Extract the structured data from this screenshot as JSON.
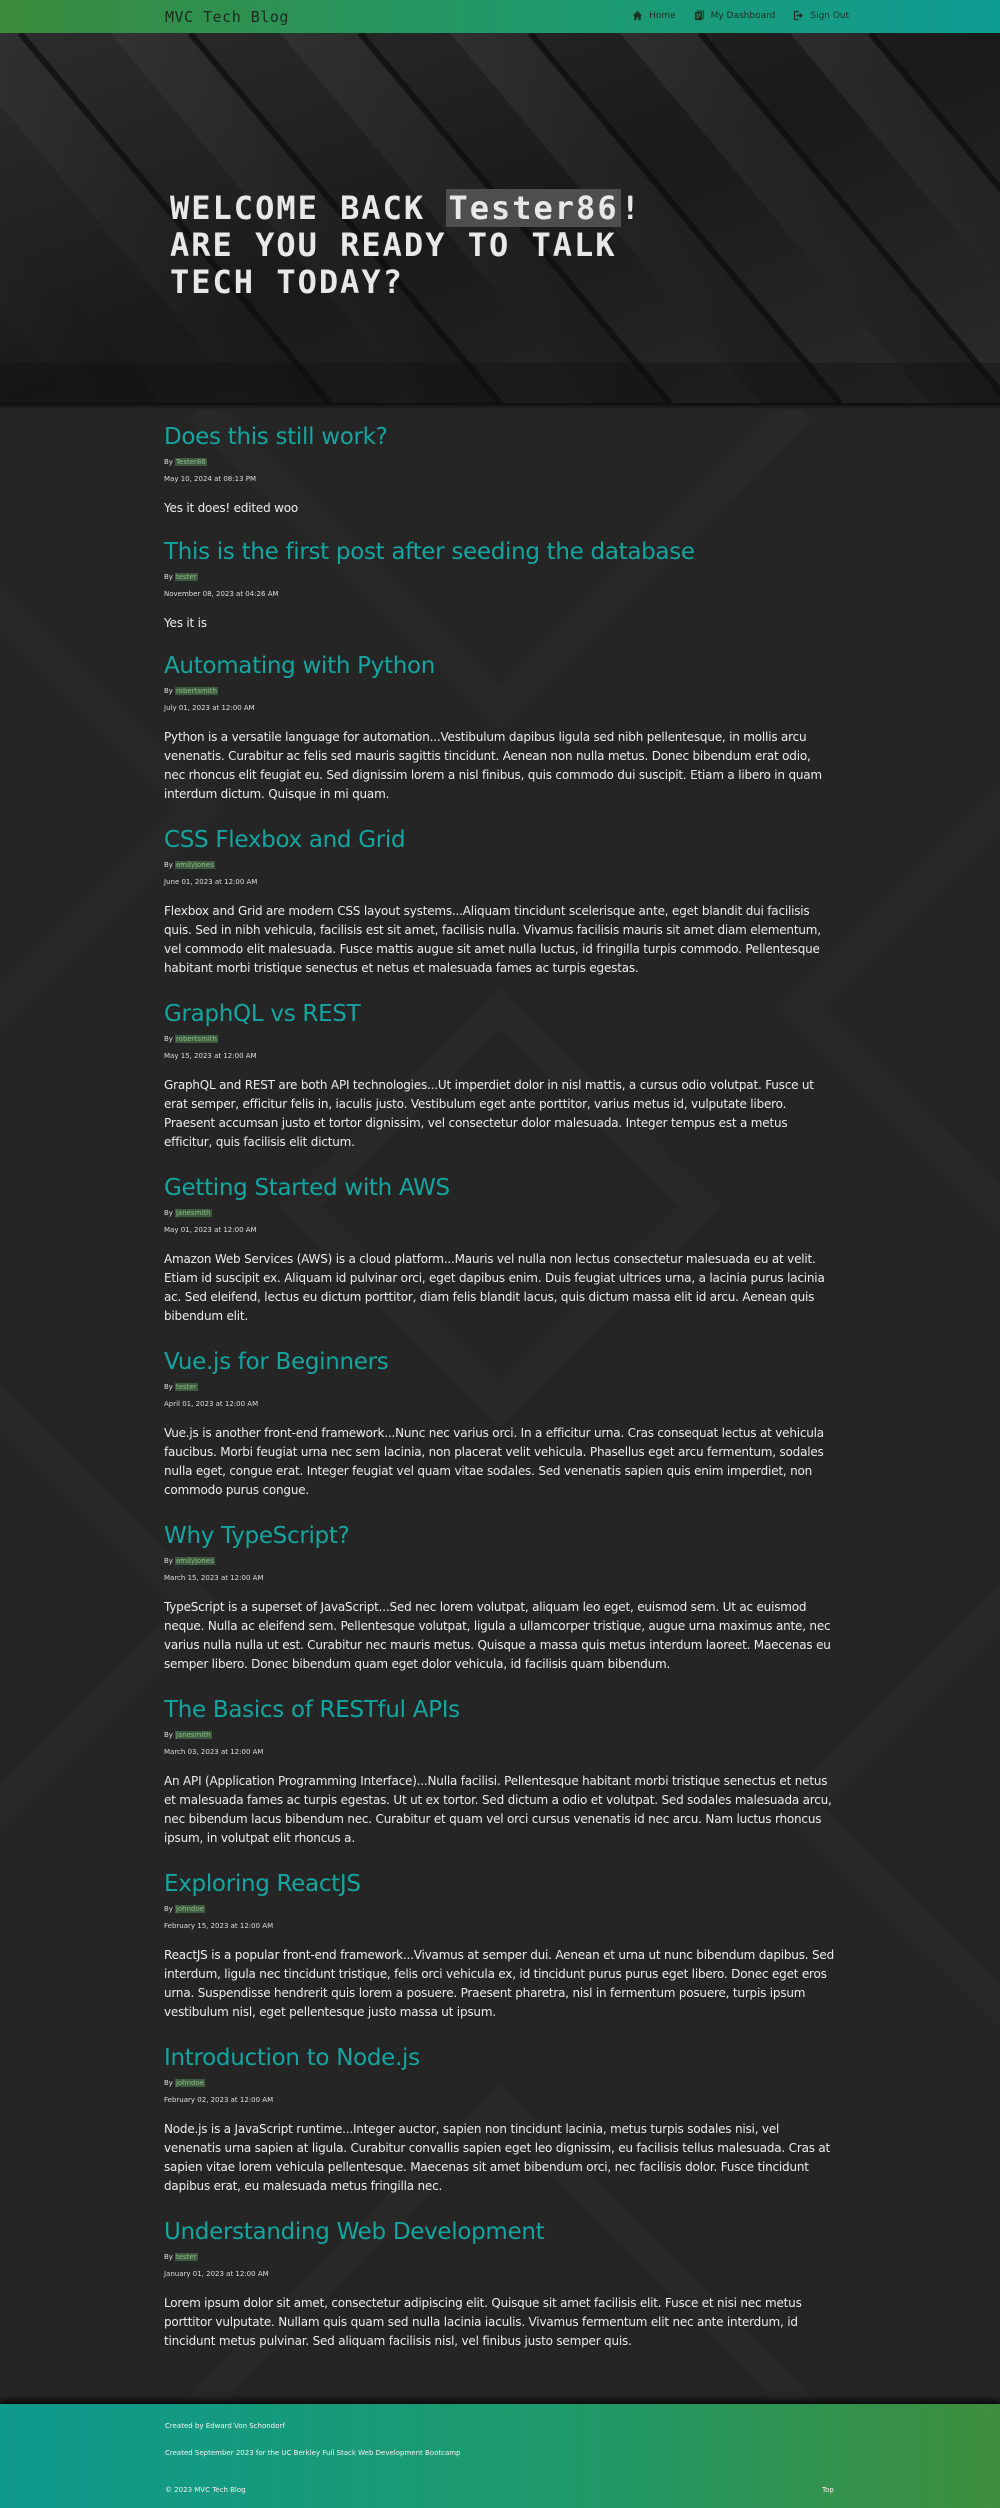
{
  "navbar": {
    "brand": "MVC Tech Blog",
    "links": [
      {
        "label": "Home",
        "icon": "home-icon"
      },
      {
        "label": "My Dashboard",
        "icon": "dashboard-icon"
      },
      {
        "label": "Sign Out",
        "icon": "sign-out-icon"
      }
    ]
  },
  "hero": {
    "line1_prefix": "Welcome back ",
    "username": "Tester86",
    "line1_suffix": "!",
    "line2": "Are you ready to talk",
    "line3": "tech today?"
  },
  "posts": [
    {
      "title": "Does this still work?",
      "by": "By",
      "author": "Tester86",
      "date": "May 10, 2024 at 08:13 PM",
      "content": "Yes it does! edited woo"
    },
    {
      "title": "This is the first post after seeding the database",
      "by": "By",
      "author": "tester",
      "date": "November 08, 2023 at 04:26 AM",
      "content": "Yes it is"
    },
    {
      "title": "Automating with Python",
      "by": "By",
      "author": "robertsmith",
      "date": "July 01, 2023 at 12:00 AM",
      "content": "Python is a versatile language for automation...Vestibulum dapibus ligula sed nibh pellentesque, in mollis arcu venenatis. Curabitur ac felis sed mauris sagittis tincidunt. Aenean non nulla metus. Donec bibendum erat odio, nec rhoncus elit feugiat eu. Sed dignissim lorem a nisl finibus, quis commodo dui suscipit. Etiam a libero in quam interdum dictum. Quisque in mi quam."
    },
    {
      "title": "CSS Flexbox and Grid",
      "by": "By",
      "author": "emilyjones",
      "date": "June 01, 2023 at 12:00 AM",
      "content": "Flexbox and Grid are modern CSS layout systems...Aliquam tincidunt scelerisque ante, eget blandit dui facilisis quis. Sed in nibh vehicula, facilisis est sit amet, facilisis nulla. Vivamus facilisis mauris sit amet diam elementum, vel commodo elit malesuada. Fusce mattis augue sit amet nulla luctus, id fringilla turpis commodo. Pellentesque habitant morbi tristique senectus et netus et malesuada fames ac turpis egestas."
    },
    {
      "title": "GraphQL vs REST",
      "by": "By",
      "author": "robertsmith",
      "date": "May 15, 2023 at 12:00 AM",
      "content": "GraphQL and REST are both API technologies...Ut imperdiet dolor in nisl mattis, a cursus odio volutpat. Fusce ut erat semper, efficitur felis in, iaculis justo. Vestibulum eget ante porttitor, varius metus id, vulputate libero. Praesent accumsan justo et tortor dignissim, vel consectetur dolor malesuada. Integer tempus est a metus efficitur, quis facilisis elit dictum."
    },
    {
      "title": "Getting Started with AWS",
      "by": "By",
      "author": "janesmith",
      "date": "May 01, 2023 at 12:00 AM",
      "content": "Amazon Web Services (AWS) is a cloud platform...Mauris vel nulla non lectus consectetur malesuada eu at velit. Etiam id suscipit ex. Aliquam id pulvinar orci, eget dapibus enim. Duis feugiat ultrices urna, a lacinia purus lacinia ac. Sed eleifend, lectus eu dictum porttitor, diam felis blandit lacus, quis dictum massa elit id arcu. Aenean quis bibendum elit."
    },
    {
      "title": "Vue.js for Beginners",
      "by": "By",
      "author": "tester",
      "date": "April 01, 2023 at 12:00 AM",
      "content": "Vue.js is another front-end framework...Nunc nec varius orci. In a efficitur urna. Cras consequat lectus at vehicula faucibus. Morbi feugiat urna nec sem lacinia, non placerat velit vehicula. Phasellus eget arcu fermentum, sodales nulla eget, congue erat. Integer feugiat vel quam vitae sodales. Sed venenatis sapien quis enim imperdiet, non commodo purus congue."
    },
    {
      "title": "Why TypeScript?",
      "by": "By",
      "author": "emilyjones",
      "date": "March 15, 2023 at 12:00 AM",
      "content": "TypeScript is a superset of JavaScript...Sed nec lorem volutpat, aliquam leo eget, euismod sem. Ut ac euismod neque. Nulla ac eleifend sem. Pellentesque volutpat, ligula a ullamcorper tristique, augue urna maximus ante, nec varius nulla nulla ut est. Curabitur nec mauris metus. Quisque a massa quis metus interdum laoreet. Maecenas eu semper libero. Donec bibendum quam eget dolor vehicula, id facilisis quam bibendum."
    },
    {
      "title": "The Basics of RESTful APIs",
      "by": "By",
      "author": "janesmith",
      "date": "March 03, 2023 at 12:00 AM",
      "content": "An API (Application Programming Interface)...Nulla facilisi. Pellentesque habitant morbi tristique senectus et netus et malesuada fames ac turpis egestas. Ut ut ex tortor. Sed dictum a odio et volutpat. Sed sodales malesuada arcu, nec bibendum lacus bibendum nec. Curabitur et quam vel orci cursus venenatis id nec arcu. Nam luctus rhoncus ipsum, in volutpat elit rhoncus a."
    },
    {
      "title": "Exploring ReactJS",
      "by": "By",
      "author": "johndoe",
      "date": "February 15, 2023 at 12:00 AM",
      "content": "ReactJS is a popular front-end framework...Vivamus at semper dui. Aenean et urna ut nunc bibendum dapibus. Sed interdum, ligula nec tincidunt tristique, felis orci vehicula ex, id tincidunt purus purus eget libero. Donec eget eros urna. Suspendisse hendrerit quis lorem a posuere. Praesent pharetra, nisl in fermentum posuere, turpis ipsum vestibulum nisl, eget pellentesque justo massa ut ipsum."
    },
    {
      "title": "Introduction to Node.js",
      "by": "By",
      "author": "johndoe",
      "date": "February 02, 2023 at 12:00 AM",
      "content": "Node.js is a JavaScript runtime...Integer auctor, sapien non tincidunt lacinia, metus turpis sodales nisi, vel venenatis urna sapien at ligula. Curabitur convallis sapien eget leo dignissim, eu facilisis tellus malesuada. Cras at sapien vitae lorem vehicula pellentesque. Maecenas sit amet bibendum orci, nec facilisis dolor. Fusce tincidunt dapibus erat, eu malesuada metus fringilla nec."
    },
    {
      "title": "Understanding Web Development",
      "by": "By",
      "author": "tester",
      "date": "January 01, 2023 at 12:00 AM",
      "content": "Lorem ipsum dolor sit amet, consectetur adipiscing elit. Quisque sit amet facilisis elit. Fusce et nisi nec metus porttitor vulputate. Nullam quis quam sed nulla lacinia iaculis. Vivamus fermentum elit nec ante interdum, id tincidunt metus pulvinar. Sed aliquam facilisis nisl, vel finibus justo semper quis."
    }
  ],
  "footer": {
    "created_by": "Created by Edward Von Schondorf",
    "created_for": "Created September 2023 for the UC Berkley Full Stack Web Development Bootcamp",
    "copyright": "© 2023 MVC Tech Blog",
    "top": "Top"
  },
  "colors": {
    "accent": "#13a6a0",
    "nav_green": "#3a8a3c",
    "nav_teal": "#0f9c95",
    "background": "#242424"
  }
}
